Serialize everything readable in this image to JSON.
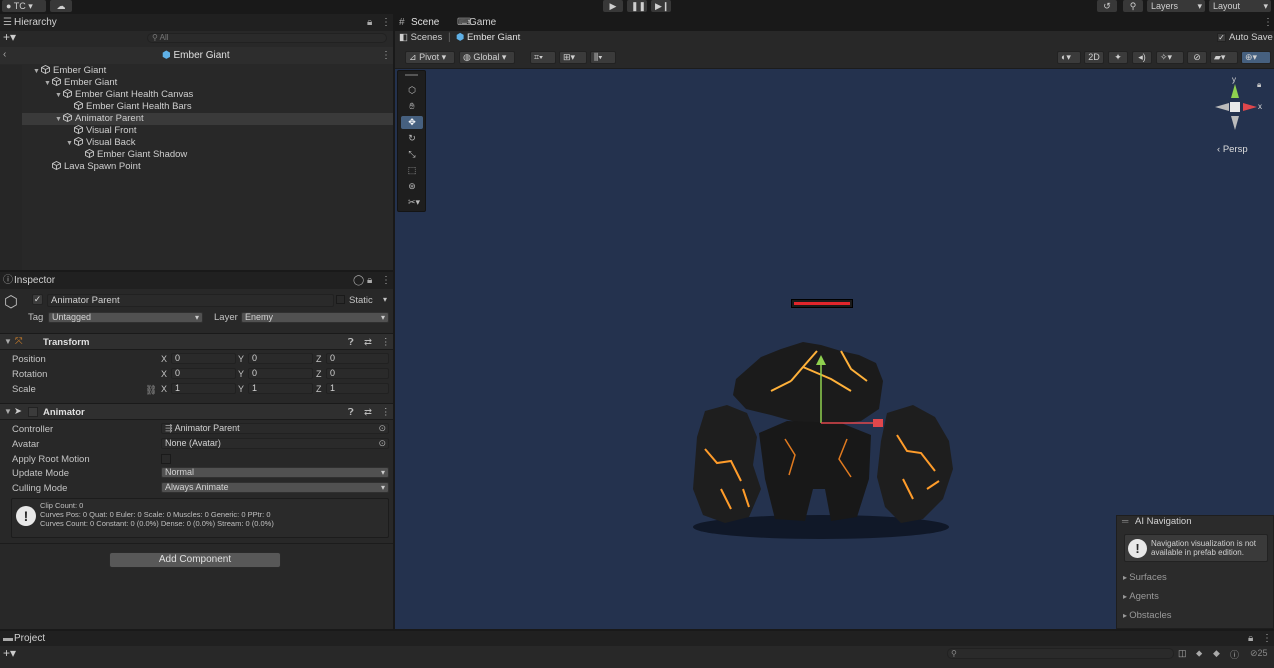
{
  "topbar": {
    "account": "TC",
    "layers": "Layers",
    "layout": "Layout"
  },
  "hierarchy": {
    "tab": "Hierarchy",
    "search_placeholder": "All",
    "prefab_title": "Ember Giant",
    "items": [
      {
        "label": "Ember Giant",
        "depth": 0,
        "expand": "▼",
        "selected": false
      },
      {
        "label": "Ember Giant",
        "depth": 1,
        "expand": "▼",
        "selected": false
      },
      {
        "label": "Ember Giant Health Canvas",
        "depth": 2,
        "expand": "▼",
        "selected": false
      },
      {
        "label": "Ember Giant Health Bars",
        "depth": 3,
        "expand": "",
        "selected": false
      },
      {
        "label": "Animator Parent",
        "depth": 2,
        "expand": "▼",
        "selected": true
      },
      {
        "label": "Visual Front",
        "depth": 3,
        "expand": "",
        "selected": false
      },
      {
        "label": "Visual Back",
        "depth": 3,
        "expand": "▼",
        "selected": false
      },
      {
        "label": "Ember Giant Shadow",
        "depth": 4,
        "expand": "",
        "selected": false
      },
      {
        "label": "Lava Spawn Point",
        "depth": 1,
        "expand": "",
        "selected": false
      }
    ]
  },
  "inspector": {
    "tab": "Inspector",
    "object_name": "Animator Parent",
    "static_label": "Static",
    "tag_label": "Tag",
    "tag_value": "Untagged",
    "layer_label": "Layer",
    "layer_value": "Enemy",
    "transform": {
      "title": "Transform",
      "rows": [
        {
          "label": "Position",
          "x": "0",
          "y": "0",
          "z": "0"
        },
        {
          "label": "Rotation",
          "x": "0",
          "y": "0",
          "z": "0"
        },
        {
          "label": "Scale",
          "x": "1",
          "y": "1",
          "z": "1"
        }
      ],
      "axis_x": "X",
      "axis_y": "Y",
      "axis_z": "Z"
    },
    "animator": {
      "title": "Animator",
      "controller_label": "Controller",
      "controller_value": "Animator Parent",
      "avatar_label": "Avatar",
      "avatar_value": "None (Avatar)",
      "apply_root_label": "Apply Root Motion",
      "update_label": "Update Mode",
      "update_value": "Normal",
      "culling_label": "Culling Mode",
      "culling_value": "Always Animate",
      "info_line1": "Clip Count: 0",
      "info_line2": "Curves Pos: 0 Quat: 0 Euler: 0 Scale: 0 Muscles: 0 Generic: 0 PPtr: 0",
      "info_line3": "Curves Count: 0 Constant: 0 (0.0%) Dense: 0 (0.0%) Stream: 0 (0.0%)"
    },
    "add_component": "Add Component"
  },
  "scene": {
    "tab_scene": "Scene",
    "tab_game": "Game",
    "breadcrumb_root": "Scenes",
    "breadcrumb_current": "Ember Giant",
    "auto_save": "Auto Save",
    "pivot": "Pivot",
    "global": "Global",
    "mode_2d": "2D",
    "persp": "Persp",
    "gizmo_y": "y",
    "gizmo_x": "x"
  },
  "ai_navigation": {
    "title": "AI Navigation",
    "message": "Navigation visualization is not available in prefab edition.",
    "sections": [
      "Surfaces",
      "Agents",
      "Obstacles"
    ]
  },
  "project": {
    "tab": "Project",
    "hidden_count": "25"
  },
  "colors": {
    "scene_bg": "#24324e",
    "selection": "#3a3a3a",
    "prefab_blue": "#5fb0e6"
  }
}
